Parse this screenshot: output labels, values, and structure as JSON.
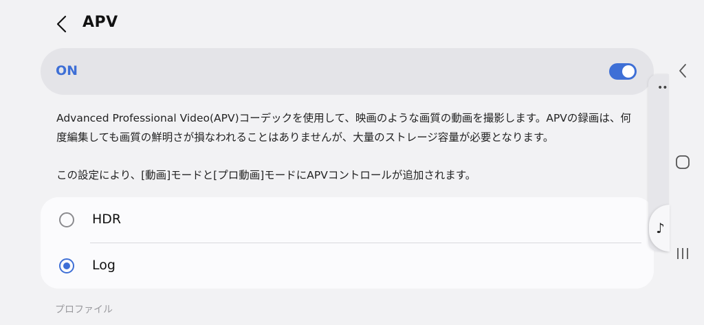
{
  "header": {
    "title": "APV"
  },
  "main_toggle": {
    "label": "ON",
    "state": "on",
    "accent": "#3e6fd6"
  },
  "description": {
    "paragraph1": "Advanced Professional Video(APV)コーデックを使用して、映画のような画質の動画を撮影します。APVの録画は、何度編集しても画質の鮮明さが損なわれることはありませんが、大量のストレージ容量が必要となります。",
    "paragraph2": "この設定により、[動画]モードと[プロ動画]モードにAPVコントロールが追加されます。"
  },
  "options": [
    {
      "label": "HDR",
      "selected": false
    },
    {
      "label": "Log",
      "selected": true
    }
  ],
  "section_label": "プロファイル",
  "edge_panel": {
    "dots": "••",
    "icon": "music-note-icon"
  },
  "nav": {
    "icons": [
      "back-icon",
      "home-icon",
      "recent-apps-icon"
    ]
  }
}
